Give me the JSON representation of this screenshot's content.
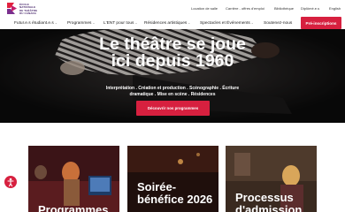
{
  "logo": {
    "text_lines": [
      "ÉCOLE",
      "NATIONALE",
      "DE THÉÂTRE",
      "DU CANADA"
    ]
  },
  "utility_nav": {
    "items": [
      "Location de salle",
      "Carrière - offres d'emploi",
      "Bibliothèque",
      "Diplômé.e.s",
      "English"
    ],
    "search_icon": "search-icon"
  },
  "main_nav": {
    "items": [
      {
        "label": "Futur.e.s étudiant.e.s",
        "has_dropdown": true
      },
      {
        "label": "Programmes",
        "has_dropdown": true
      },
      {
        "label": "L'ENT pour tous",
        "has_dropdown": true
      },
      {
        "label": "Résidences artistiques",
        "has_dropdown": true
      },
      {
        "label": "Spectacles et Événements",
        "has_dropdown": true
      },
      {
        "label": "Soutenez-nous",
        "has_dropdown": false
      }
    ],
    "cta": "Pré-inscriptions"
  },
  "hero": {
    "title": "Le théâtre se joue ici depuis 1960",
    "subtitle": "Interprétation . Création et production . Scénographie . Écriture dramatique . Mise en scène . Résidences",
    "cta": "Découvrir nos programmes"
  },
  "cards": [
    {
      "title": "Programmes"
    },
    {
      "title": "Soirée-bénéfice 2026"
    },
    {
      "title": "Processus d'admission"
    }
  ],
  "colors": {
    "brand_red": "#d7203f",
    "brand_purple": "#4b2a6e",
    "hero_bg": "#0c0c0c"
  }
}
